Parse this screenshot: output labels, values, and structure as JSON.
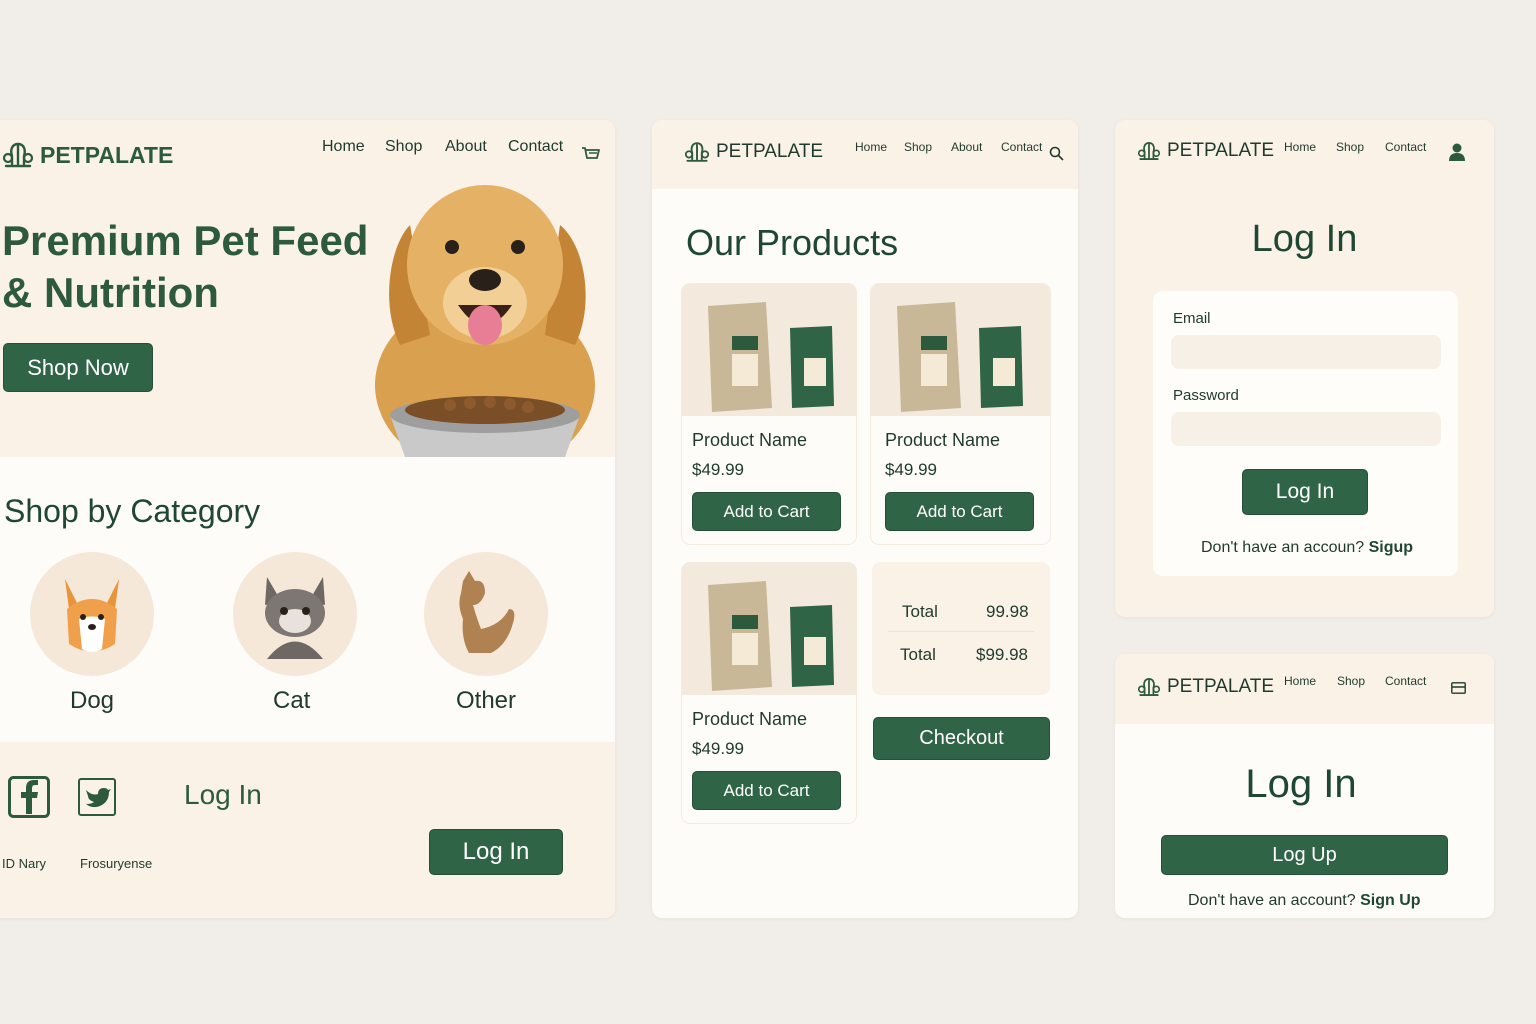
{
  "brand": {
    "name": "PETPALATE"
  },
  "colors": {
    "accent": "#2f6446",
    "cream": "#fbf2e7",
    "text": "#1f3a2c",
    "page_bg": "#f1ede9"
  },
  "home": {
    "nav": [
      "Home",
      "Shop",
      "About",
      "Contact"
    ],
    "cart_icon": "cart-icon",
    "hero": {
      "title_line1": "Premium Pet Feed",
      "title_line2": "& Nutrition",
      "cta": "Shop Now"
    },
    "category_title": "Shop by Category",
    "categories": [
      {
        "label": "Dog",
        "icon": "dog-icon"
      },
      {
        "label": "Cat",
        "icon": "cat-icon"
      },
      {
        "label": "Other",
        "icon": "pet-icon"
      }
    ],
    "footer": {
      "social": [
        "facebook-icon",
        "twitter-icon"
      ],
      "login_text": "Log In",
      "login_button": "Log In",
      "link1": "ID Nary",
      "link2": "Frosuryense"
    }
  },
  "products": {
    "nav": [
      "Home",
      "Shop",
      "About",
      "Contact"
    ],
    "search_icon": "search-icon",
    "title": "Our Products",
    "items": [
      {
        "name": "Product Name",
        "price": "$49.99",
        "button": "Add to Cart"
      },
      {
        "name": "Product Name",
        "price": "$49.99",
        "button": "Add to Cart"
      },
      {
        "name": "Product Name",
        "price": "$49.99",
        "button": "Add to Cart"
      }
    ],
    "summary": [
      {
        "label": "Total",
        "value": "99.98"
      },
      {
        "label": "Total",
        "value": "$99.98"
      }
    ],
    "checkout": "Checkout"
  },
  "login1": {
    "nav": [
      "Home",
      "Shop",
      "Contact"
    ],
    "user_icon": "user-icon",
    "title": "Log In",
    "email_label": "Email",
    "password_label": "Password",
    "button": "Log In",
    "footer_text": "Don't have an accoun?",
    "footer_link": "Sigup"
  },
  "login2": {
    "nav": [
      "Home",
      "Shop",
      "Contact"
    ],
    "menu_icon": "menu-icon",
    "title": "Log In",
    "button": "Log Up",
    "footer_text": "Don't have an account?",
    "footer_link": "Sign Up"
  }
}
